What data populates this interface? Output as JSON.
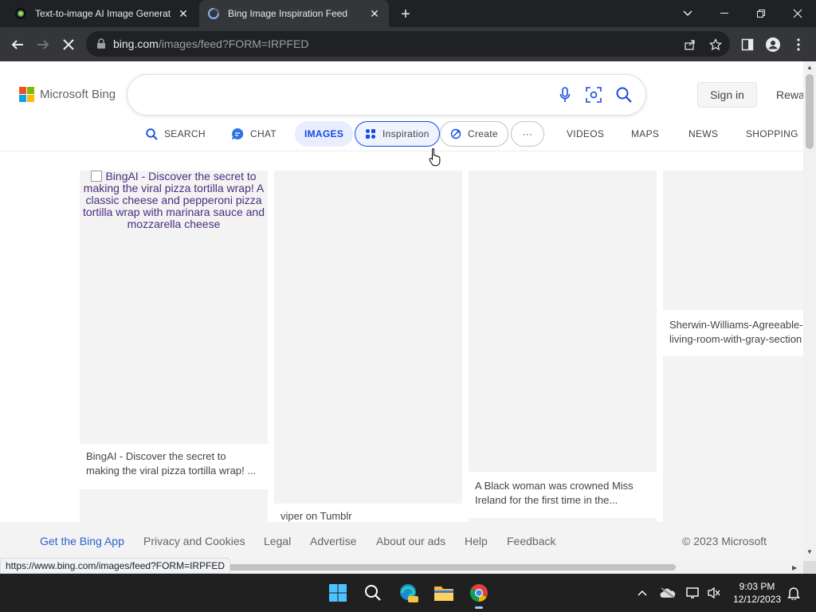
{
  "browser": {
    "tabs": [
      {
        "title": "Text-to-image AI Image Generat",
        "active": false
      },
      {
        "title": "Bing Image Inspiration Feed",
        "active": true
      }
    ],
    "url_host": "bing.com",
    "url_path": "/images/feed?FORM=IRPFED"
  },
  "header": {
    "brand": "Microsoft Bing",
    "search_value": "",
    "signin_label": "Sign in",
    "rewards_label": "Rewa"
  },
  "scopes": {
    "search": "SEARCH",
    "chat": "CHAT",
    "images": "IMAGES",
    "inspiration": "Inspiration",
    "create": "Create",
    "more": "···",
    "videos": "VIDEOS",
    "maps": "MAPS",
    "news": "NEWS",
    "shopping": "SHOPPING"
  },
  "feed": {
    "card1_alt": "BingAI - Discover the secret to making the viral pizza tortilla wrap! A classic cheese and pepperoni pizza tortilla wrap with marinara sauce and mozzarella cheese",
    "card1_caption_line1": "BingAI - Discover the secret to",
    "card1_caption_line2": "making the viral pizza tortilla wrap! ...",
    "card2_caption": "viper on Tumblr",
    "card3_caption_line1": "A Black woman was crowned Miss",
    "card3_caption_line2": "Ireland for the first time in the...",
    "card4_caption_line1": "Sherwin-Williams-Agreeable-",
    "card4_caption_line2": "living-room-with-gray-section"
  },
  "footer": {
    "app": "Get the Bing App",
    "privacy": "Privacy and Cookies",
    "legal": "Legal",
    "advertise": "Advertise",
    "about_ads": "About our ads",
    "help": "Help",
    "feedback": "Feedback",
    "copyright": "© 2023 Microsoft"
  },
  "status_url": "https://www.bing.com/images/feed?FORM=IRPFED",
  "taskbar": {
    "time": "9:03 PM",
    "date": "12/12/2023"
  },
  "colors": {
    "bing_blue": "#174ae4",
    "ms_red": "#f25022",
    "ms_green": "#7fba00",
    "ms_blue": "#00a4ef",
    "ms_yellow": "#ffb900"
  }
}
